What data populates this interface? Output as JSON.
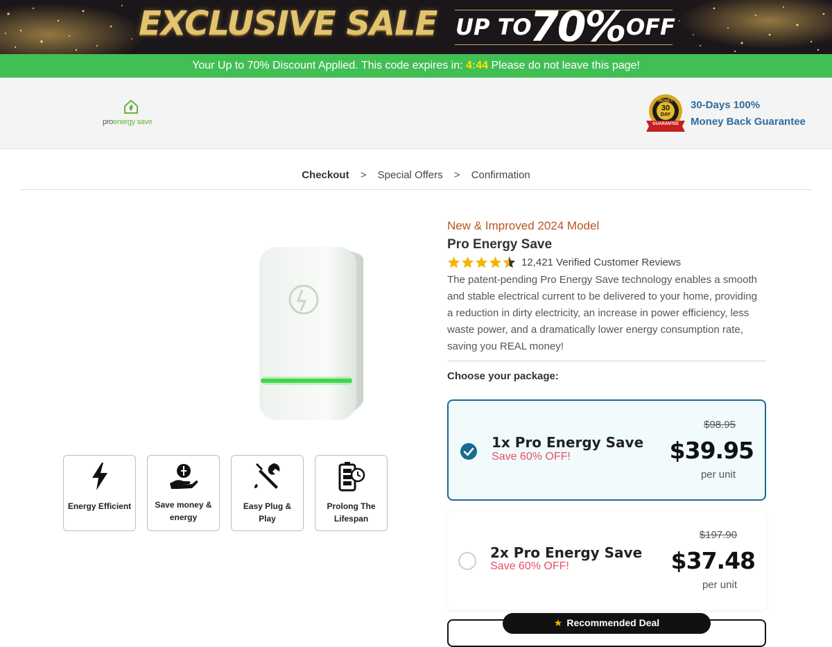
{
  "banner": {
    "title": "EXCLUSIVE SALE",
    "up_to": "UP TO",
    "percent": "70%",
    "off": "OFF"
  },
  "discount_bar": {
    "prefix": "Your Up to 70% Discount Applied. This code expires in: ",
    "timer": "4:44",
    "suffix": " Please do not leave this page!"
  },
  "header": {
    "logo_text_pro": "pro",
    "logo_text_energy": "energy save",
    "guarantee_line1": "30-Days 100%",
    "guarantee_line2": "Money Back Guarantee",
    "badge_top": "MONEY BACK",
    "badge_mid": "30",
    "badge_day": "DAY",
    "badge_ribbon": "GUARANTEE"
  },
  "breadcrumb": {
    "items": [
      "Checkout",
      "Special Offers",
      "Confirmation"
    ],
    "separator": ">"
  },
  "features": [
    {
      "label": "Energy Efficient",
      "icon": "lightning-icon"
    },
    {
      "label": "Save money & energy",
      "icon": "money-hand-icon"
    },
    {
      "label": "Easy Plug & Play",
      "icon": "tools-icon"
    },
    {
      "label": "Prolong The Lifespan",
      "icon": "battery-clock-icon"
    }
  ],
  "product": {
    "model": "New & Improved 2024 Model",
    "name": "Pro Energy Save",
    "rating": 4.5,
    "reviews": "12,421 Verified Customer Reviews",
    "description": "The patent-pending Pro Energy Save technology enables a smooth and stable electrical current to be delivered to your home, providing a reduction in dirty electricity, an increase in power efficiency, less waste power, and a dramatically lower energy consumption rate, saving you REAL money!",
    "choose_label": "Choose your package:"
  },
  "packages": [
    {
      "title": "1x Pro Energy Save",
      "save": "Save 60% OFF!",
      "old_price": "$98.95",
      "price": "$39.95",
      "unit": "per unit",
      "selected": true
    },
    {
      "title": "2x Pro Energy Save",
      "save": "Save 60% OFF!",
      "old_price": "$197.90",
      "price": "$37.48",
      "unit": "per unit",
      "selected": false
    }
  ],
  "recommended": {
    "label": "Recommended Deal"
  },
  "colors": {
    "green_bar": "#41bf54",
    "timer": "#ffe500",
    "accent_blue": "#196a92",
    "model_orange": "#b5561e",
    "save_pink": "#e5506a",
    "star": "#f5b400"
  }
}
